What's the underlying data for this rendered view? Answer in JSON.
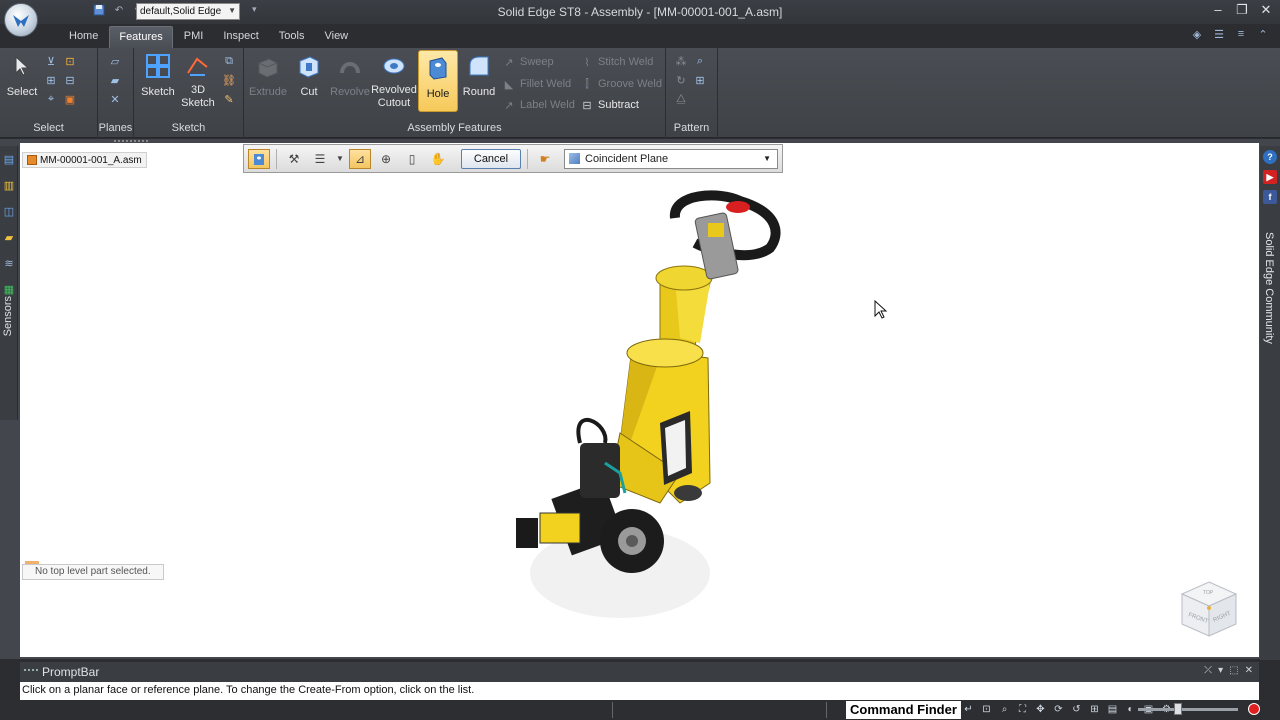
{
  "titlebar": {
    "environment": "default,Solid Edge",
    "window_title": "Solid Edge ST8 - Assembly - [MM-00001-001_A.asm]"
  },
  "tabs": [
    "Home",
    "Features",
    "PMI",
    "Inspect",
    "Tools",
    "View"
  ],
  "ribbon": {
    "select": {
      "label": "Select",
      "group": "Select"
    },
    "planes": {
      "group": "Planes"
    },
    "sketch": {
      "sketch": "Sketch",
      "sketch3d_line1": "3D",
      "sketch3d_line2": "Sketch",
      "group": "Sketch"
    },
    "assembly_features": {
      "extrude": "Extrude",
      "cut": "Cut",
      "revolve": "Revolve",
      "revolved_cutout_line1": "Revolved",
      "revolved_cutout_line2": "Cutout",
      "hole": "Hole",
      "round": "Round",
      "sweep": "Sweep",
      "fillet_weld": "Fillet Weld",
      "label_weld": "Label Weld",
      "stitch_weld": "Stitch Weld",
      "groove_weld": "Groove Weld",
      "subtract": "Subtract",
      "group": "Assembly Features"
    },
    "pattern": {
      "group": "Pattern"
    }
  },
  "document_tab": "MM-00001-001_A.asm",
  "command_bar": {
    "cancel": "Cancel",
    "create_from": "Coincident Plane"
  },
  "left_panel": {
    "sensors": "Sensors"
  },
  "right_panel": {
    "community": "Solid Edge Community"
  },
  "status_tip": "No top level part selected.",
  "promptbar": {
    "title": "PromptBar",
    "message": "Click on a planar face or reference plane.  To change the Create-From option, click on the list."
  },
  "statusbar": {
    "command_finder": "Command Finder"
  },
  "viewcube": {
    "front": "FRONT",
    "right": "RIGHT",
    "top": "TOP"
  },
  "colors": {
    "accent": "#f6c95a",
    "model_yellow": "#f2d21e",
    "ribbon_bg": "#45484e"
  }
}
